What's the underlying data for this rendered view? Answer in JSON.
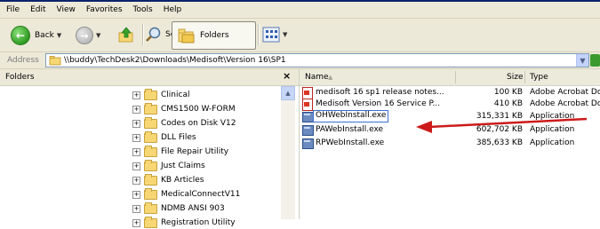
{
  "menu": [
    "File",
    "Edit",
    "View",
    "Favorites",
    "Tools",
    "Help"
  ],
  "toolbar": {
    "back_label": "Back",
    "search_label": "Search",
    "folders_label": "Folders"
  },
  "address": {
    "label": "Address",
    "value": "\\\\buddy\\TechDesk2\\Downloads\\Medisoft\\Version 16\\SP1"
  },
  "folders_pane": {
    "title": "Folders",
    "items": [
      "Clinical",
      "CMS1500 W-FORM",
      "Codes on Disk V12",
      "DLL Files",
      "File Repair Utility",
      "Just Claims",
      "KB Articles",
      "MedicalConnectV11",
      "NDMB ANSI 903",
      "Registration Utility"
    ]
  },
  "file_list": {
    "columns": {
      "name": "Name",
      "size": "Size",
      "type": "Type"
    },
    "files": [
      {
        "name": "medisoft 16 sp1 release notes...",
        "size": "100 KB",
        "type": "Adobe Acrobat Doc...",
        "icon": "pdf-icon"
      },
      {
        "name": "Medisoft Version 16 Service P...",
        "size": "410 KB",
        "type": "Adobe Acrobat Doc...",
        "icon": "pdf-icon"
      },
      {
        "name": "OHWebInstall.exe",
        "size": "315,331 KB",
        "type": "Application",
        "icon": "exe-icon"
      },
      {
        "name": "PAWebInstall.exe",
        "size": "602,702 KB",
        "type": "Application",
        "icon": "exe-icon"
      },
      {
        "name": "RPWebInstall.exe",
        "size": "385,633 KB",
        "type": "Application",
        "icon": "exe-icon"
      }
    ]
  },
  "colors": {
    "annotation_arrow": "#cc1a1a",
    "selection_border": "#3b6ed6"
  }
}
